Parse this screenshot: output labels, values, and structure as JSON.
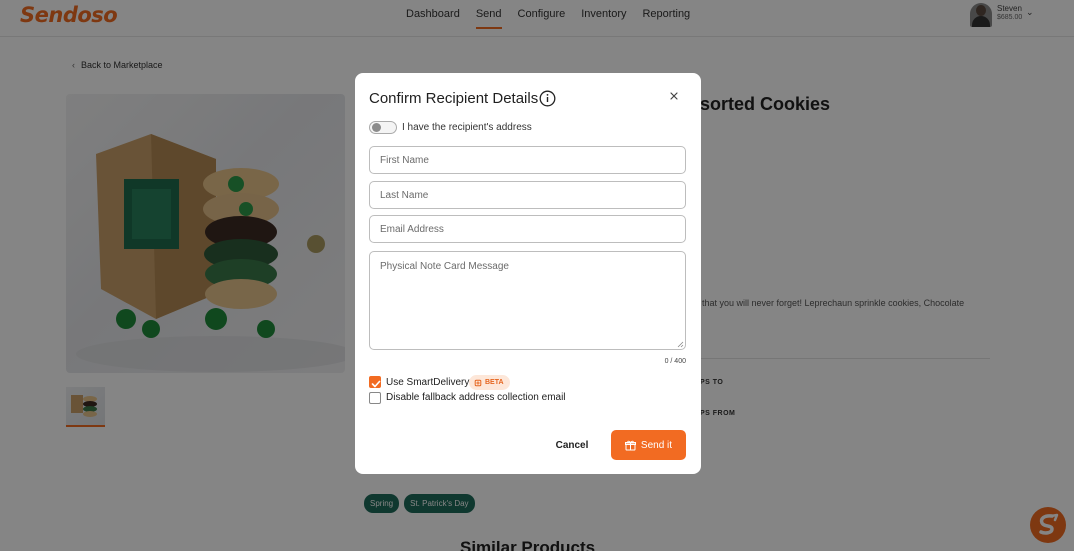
{
  "brand": {
    "logo_text": "Sendoso",
    "accent_color": "#f26b22"
  },
  "nav": {
    "links": [
      "Dashboard",
      "Send",
      "Configure",
      "Inventory",
      "Reporting"
    ],
    "active": "Send"
  },
  "user": {
    "name": "Steven",
    "balance": "$685.00",
    "avatar": "user-avatar-photo"
  },
  "page": {
    "back_link": "Back to Marketplace",
    "product_title_visible": "sorted Cookies",
    "description_line_1": "that you will never forget! Leprechaun sprinkle cookies, Chocolate",
    "description_line_2": "",
    "ships_to_label": "PS TO",
    "ships_from_label": "PS FROM",
    "tags": [
      "Spring",
      "St. Patrick's Day"
    ],
    "similar_products_heading": "Similar Products",
    "tag_color": "#1e6b5a"
  },
  "modal": {
    "title": "Confirm Recipient Details",
    "title_icon": "info-icon",
    "close_icon": "close-icon",
    "toggle": {
      "label": "I have the recipient's address",
      "on": false
    },
    "fields": {
      "first_name": {
        "placeholder": "First Name",
        "value": ""
      },
      "last_name": {
        "placeholder": "Last Name",
        "value": ""
      },
      "email": {
        "placeholder": "Email Address",
        "value": ""
      },
      "note": {
        "placeholder": "Physical Note Card Message",
        "value": ""
      }
    },
    "char_count": "0 / 400",
    "smart_delivery": {
      "label": "Use SmartDelivery",
      "checked": true,
      "badge": "BETA",
      "badge_icon": "sparkle-icon"
    },
    "fallback": {
      "label": "Disable fallback address collection email",
      "checked": false
    },
    "cancel_label": "Cancel",
    "send_label": "Send it",
    "send_icon": "gift-icon"
  }
}
